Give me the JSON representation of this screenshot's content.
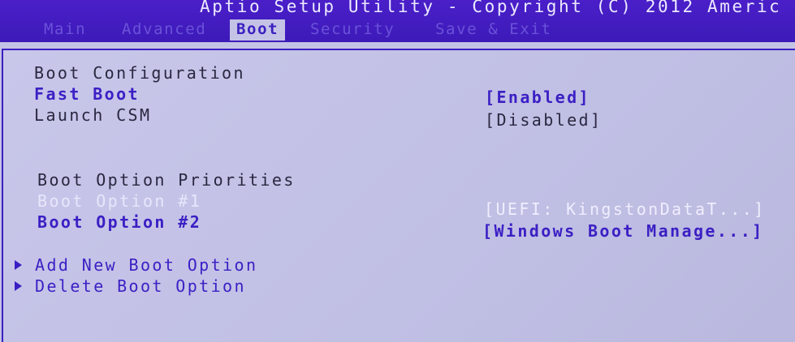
{
  "header": {
    "title": "Aptio Setup Utility - Copyright (C) 2012 Americ",
    "tabs": [
      {
        "label": "Main"
      },
      {
        "label": "Advanced"
      },
      {
        "label": "Boot"
      },
      {
        "label": "Security"
      },
      {
        "label": "Save & Exit"
      }
    ],
    "active_tab": "Boot"
  },
  "boot": {
    "section1_heading": "Boot Configuration",
    "fast_boot": {
      "label": "Fast Boot",
      "value": "[Enabled]"
    },
    "launch_csm": {
      "label": "Launch CSM",
      "value": "[Disabled]"
    },
    "section2_heading": "Boot Option Priorities",
    "boot_option_1": {
      "label": "Boot Option #1",
      "value": "[UEFI: KingstonDataT...]"
    },
    "boot_option_2": {
      "label": "Boot Option #2",
      "value": "[Windows Boot Manage...]"
    },
    "add_new": "Add New Boot Option",
    "delete": "Delete Boot Option"
  },
  "colors": {
    "header_bg": "#3d1ab8",
    "panel_bg": "#c4c3e6",
    "highlight_text": "#3b1fc4",
    "static_text": "#2a2740"
  }
}
